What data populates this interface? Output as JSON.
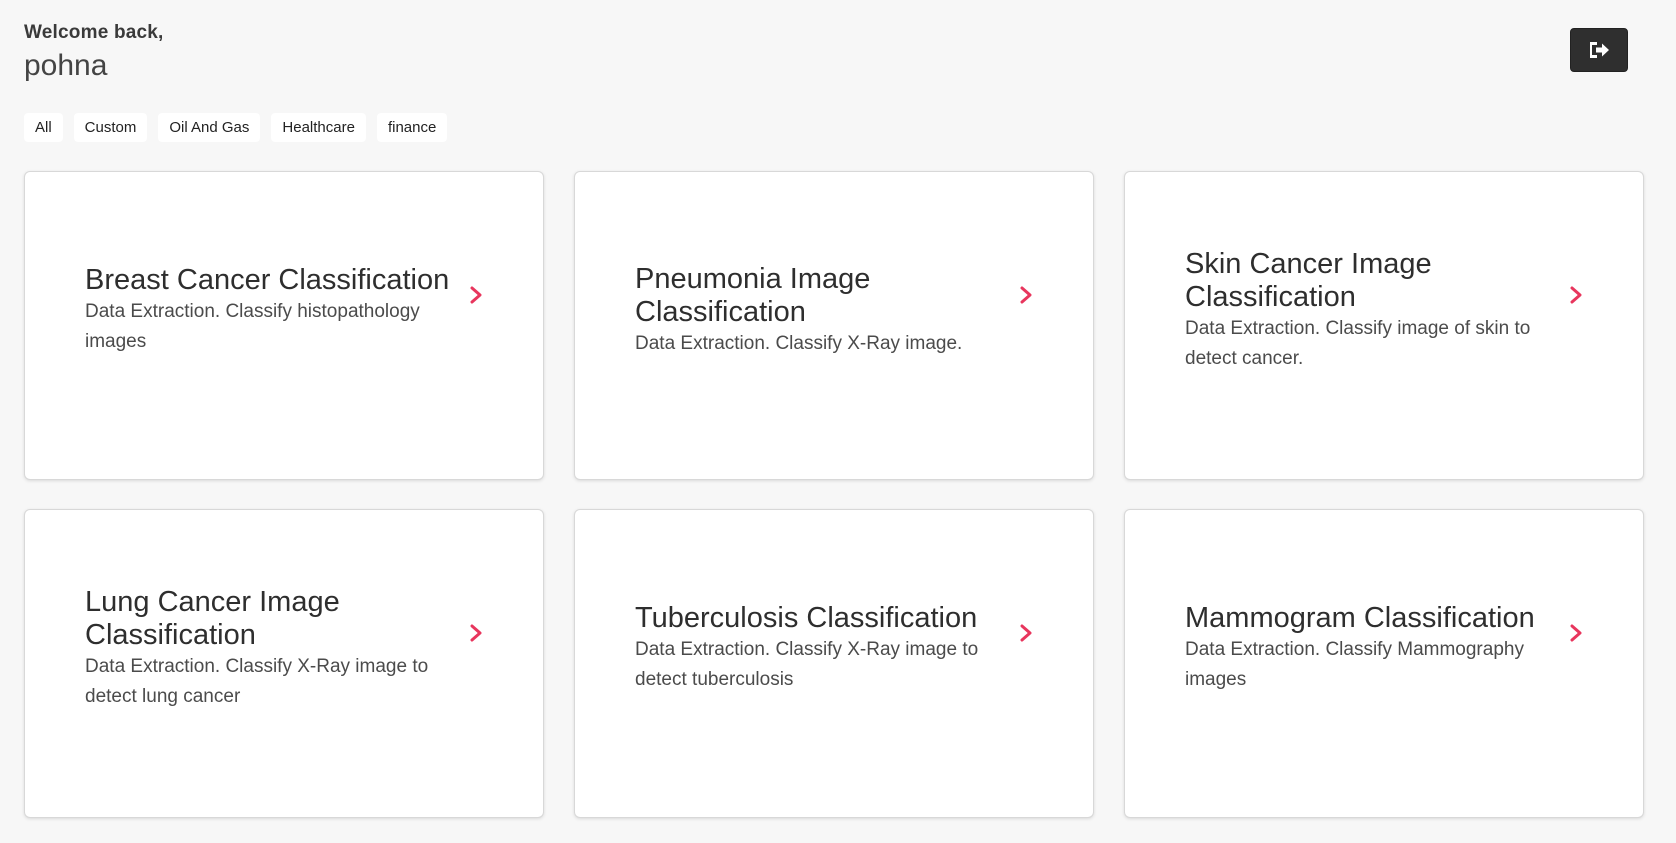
{
  "header": {
    "welcome": "Welcome back,",
    "username": "pohna"
  },
  "logout": {
    "icon": "sign-out-icon"
  },
  "filters": [
    "All",
    "Custom",
    "Oil And Gas",
    "Healthcare",
    "finance"
  ],
  "cards": [
    {
      "title": "Breast Cancer Classification",
      "description": "Data Extraction. Classify histopathology images"
    },
    {
      "title": "Pneumonia Image Classification",
      "description": "Data Extraction. Classify X-Ray image."
    },
    {
      "title": "Skin Cancer Image Classification",
      "description": "Data Extraction. Classify image of skin to detect cancer."
    },
    {
      "title": "Lung Cancer Image Classification",
      "description": "Data Extraction. Classify X-Ray image to detect lung cancer"
    },
    {
      "title": "Tuberculosis Classification",
      "description": "Data Extraction. Classify X-Ray image to detect tuberculosis"
    },
    {
      "title": "Mammogram Classification",
      "description": "Data Extraction. Classify Mammography images"
    }
  ],
  "colors": {
    "accent": "#e8365d",
    "background": "#f7f7f7",
    "button_dark": "#2f2f2f"
  }
}
